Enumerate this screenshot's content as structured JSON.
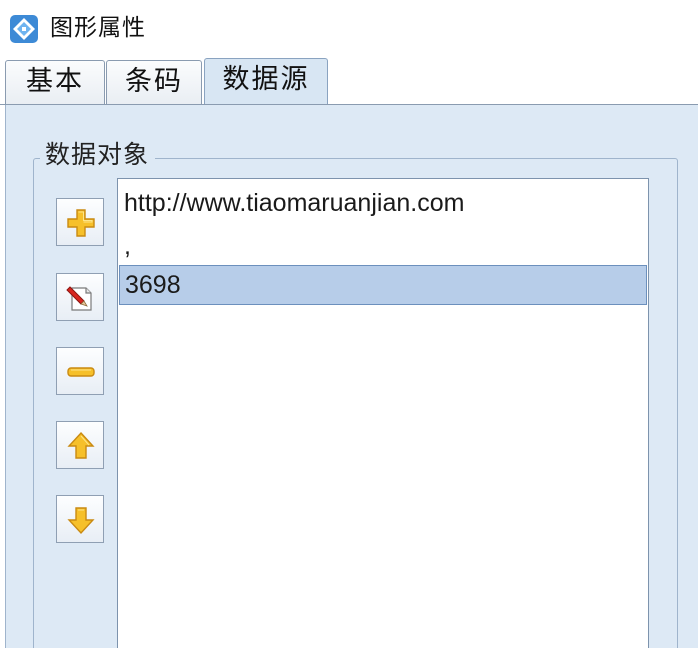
{
  "window": {
    "title": "图形属性",
    "icon": "app-diamond-icon"
  },
  "tabs": [
    {
      "label": "基本",
      "active": false
    },
    {
      "label": "条码",
      "active": false
    },
    {
      "label": "数据源",
      "active": true
    }
  ],
  "data_source": {
    "group_label": "数据对象",
    "buttons": [
      {
        "name": "add-button",
        "icon": "plus-icon"
      },
      {
        "name": "edit-button",
        "icon": "edit-pencil-icon"
      },
      {
        "name": "remove-button",
        "icon": "minus-icon"
      },
      {
        "name": "move-up-button",
        "icon": "arrow-up-icon"
      },
      {
        "name": "move-down-button",
        "icon": "arrow-down-icon"
      }
    ],
    "items": [
      {
        "text": "http://www.tiaomaruanjian.com",
        "selected": false
      },
      {
        "text": ",",
        "selected": false
      },
      {
        "text": "3698",
        "selected": true
      }
    ]
  },
  "colors": {
    "panel_bg": "#dde9f5",
    "active_tab_bg": "#d8e6f3",
    "selected_item_bg": "#b7cde9",
    "icon_accent": "#f3b81c"
  }
}
